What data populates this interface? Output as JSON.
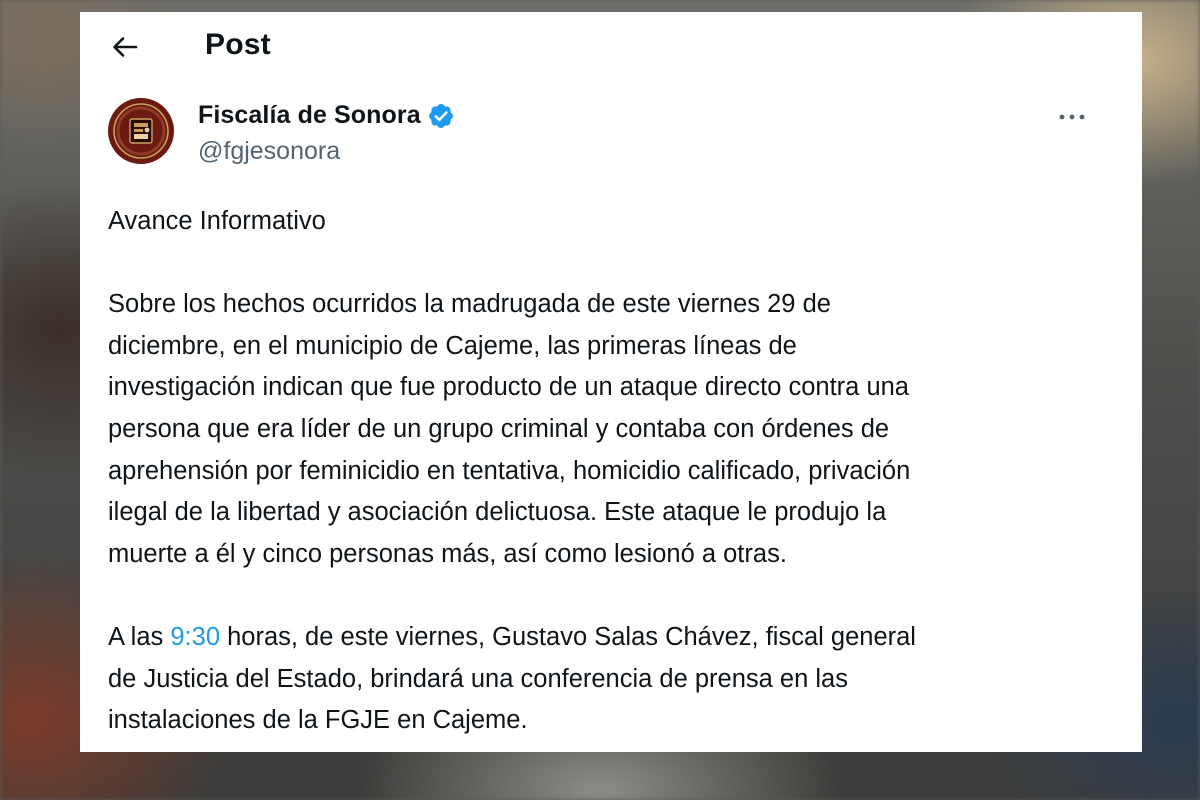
{
  "header": {
    "title": "Post",
    "back_icon": "arrow-left-icon"
  },
  "author": {
    "display_name": "Fiscalía de Sonora",
    "handle": "@fgjesonora",
    "verified": true,
    "verified_color": "#1d9bf0",
    "avatar_colors": [
      "#6b1a12",
      "#c9a25a"
    ]
  },
  "more_icon": "more-horizontal-icon",
  "post": {
    "heading": "Avance Informativo",
    "paragraph_1_lines": [
      "Sobre los hechos ocurridos la madrugada de este viernes 29 de",
      "diciembre, en el municipio de Cajeme, las primeras líneas de",
      "investigación indican que fue producto de un ataque directo contra una",
      "persona que era líder de un grupo criminal y contaba con órdenes de",
      "aprehensión por feminicidio en tentativa, homicidio calificado, privación",
      "ilegal de la libertad y asociación delictuosa. Este ataque le produjo la",
      "muerte a él y cinco personas más, así como lesionó a otras."
    ],
    "paragraph_2": {
      "prefix": "A las ",
      "time_link": "9:30",
      "line_1_rest": " horas, de este viernes, Gustavo Salas Chávez, fiscal general",
      "line_2": "de Justicia del Estado, brindará una conferencia de prensa en las",
      "line_3": "instalaciones de la FGJE en Cajeme."
    }
  },
  "colors": {
    "text": "#0f1419",
    "secondary_text": "#536471",
    "link": "#1d9bf0",
    "card_background": "#ffffff"
  }
}
